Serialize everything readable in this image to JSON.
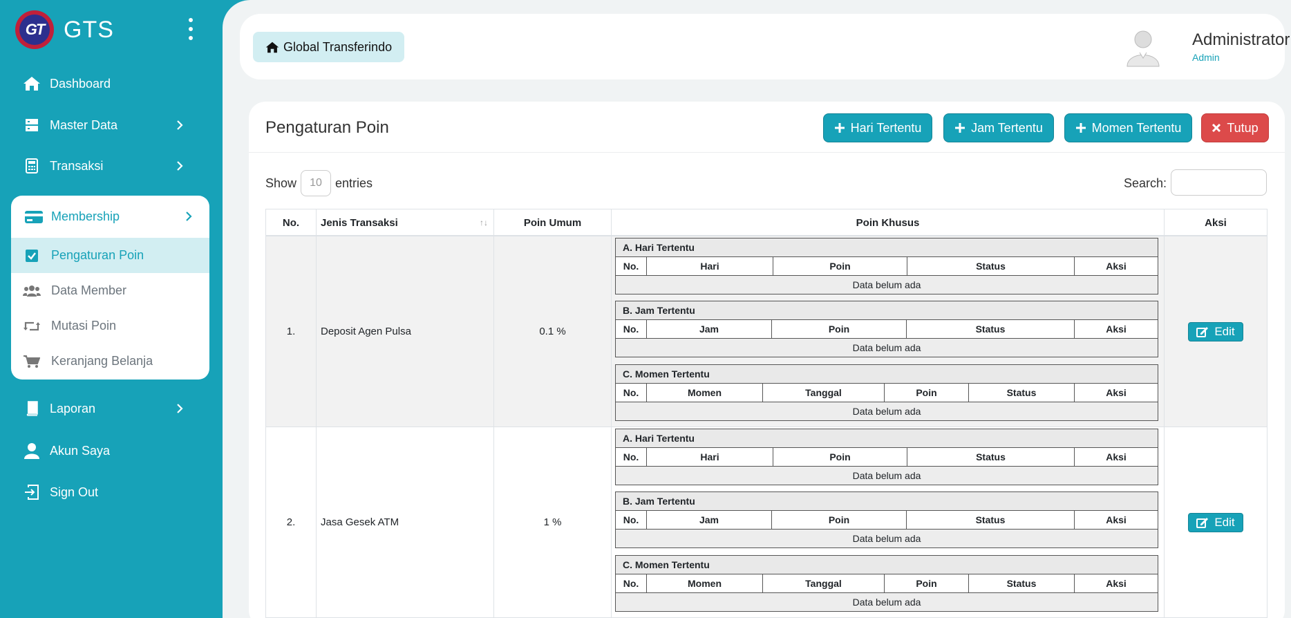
{
  "brand": {
    "name": "GTS",
    "logo_text": "GT"
  },
  "sidebar": {
    "items": [
      {
        "label": "Dashboard"
      },
      {
        "label": "Master Data"
      },
      {
        "label": "Transaksi"
      },
      {
        "label": "Membership"
      },
      {
        "label": "Laporan"
      },
      {
        "label": "Akun Saya"
      },
      {
        "label": "Sign Out"
      }
    ],
    "membership_sub": [
      {
        "label": "Pengaturan Poin"
      },
      {
        "label": "Data Member"
      },
      {
        "label": "Mutasi Poin"
      },
      {
        "label": "Keranjang Belanja"
      }
    ]
  },
  "topbar": {
    "home_label": "Global Transferindo",
    "user_name": "Administrator",
    "user_role": "Admin"
  },
  "page": {
    "title": "Pengaturan Poin",
    "buttons": {
      "hari": "Hari Tertentu",
      "jam": "Jam Tertentu",
      "momen": "Momen Tertentu",
      "tutup": "Tutup"
    },
    "show_label": "Show",
    "entries_value": "10",
    "entries_label": "entries",
    "search_label": "Search:"
  },
  "table": {
    "headers": {
      "no": "No.",
      "jenis": "Jenis Transaksi",
      "umum": "Poin Umum",
      "khusus": "Poin Khusus",
      "aksi": "Aksi"
    },
    "sub": {
      "hari_title": "A. Hari Tertentu",
      "jam_title": "B. Jam Tertentu",
      "momen_title": "C. Momen Tertentu",
      "col_no": "No.",
      "col_hari": "Hari",
      "col_jam": "Jam",
      "col_momen": "Momen",
      "col_tanggal": "Tanggal",
      "col_poin": "Poin",
      "col_status": "Status",
      "col_aksi": "Aksi",
      "empty": "Data belum ada"
    },
    "edit_label": "Edit",
    "rows": [
      {
        "no": "1.",
        "jenis": "Deposit Agen Pulsa",
        "umum": "0.1 %"
      },
      {
        "no": "2.",
        "jenis": "Jasa Gesek ATM",
        "umum": "1 %"
      }
    ]
  },
  "colors": {
    "accent": "#17a2b8",
    "danger": "#dc4a4a",
    "background": "#f0f3f4"
  }
}
